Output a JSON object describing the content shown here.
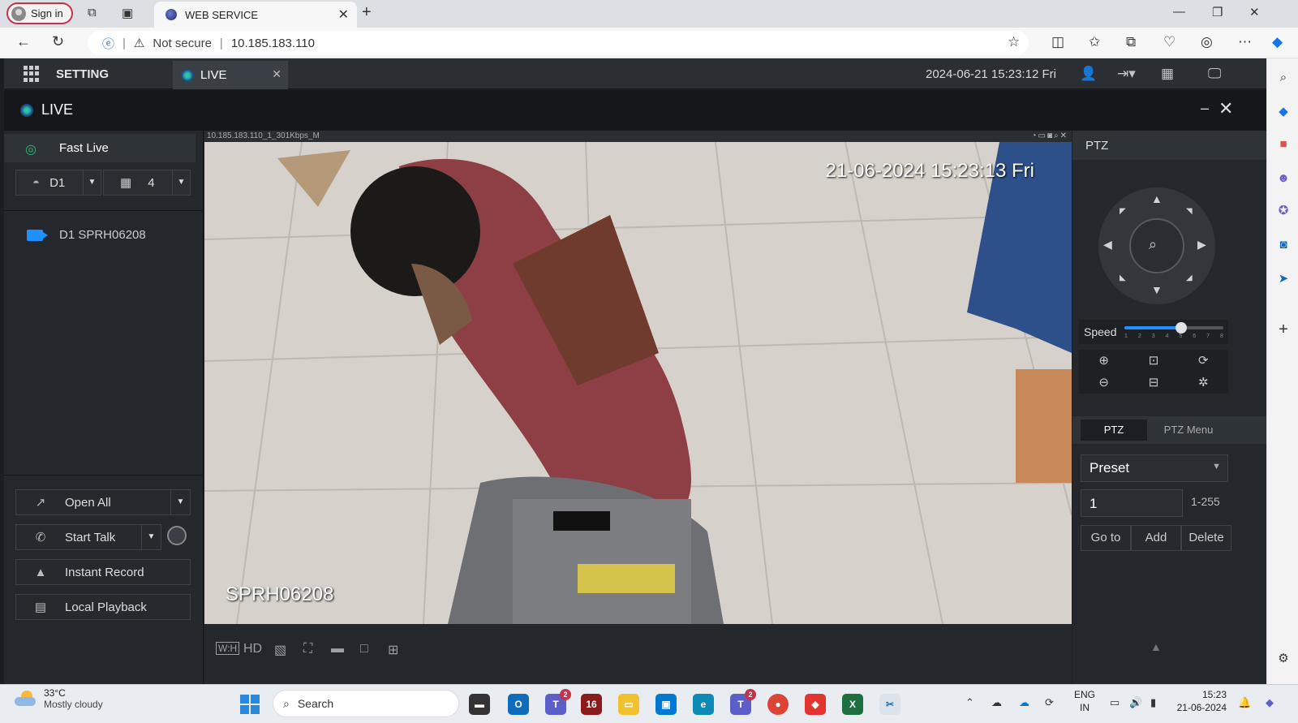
{
  "browser": {
    "signin_label": "Sign in",
    "tab_title": "WEB SERVICE",
    "not_secure_label": "Not secure",
    "url": "10.185.183.110"
  },
  "app": {
    "setting_label": "SETTING",
    "live_tab_label": "LIVE",
    "datetime": "2024-06-21 15:23:12 Fri",
    "live_panel_title": "LIVE"
  },
  "left_panel": {
    "fast_live_label": "Fast Live",
    "device_select": "D1",
    "split_select": "4",
    "device_item": "D1 SPRH06208",
    "buttons": {
      "open_all": "Open All",
      "start_talk": "Start Talk",
      "instant_record": "Instant Record",
      "local_playback": "Local Playback"
    }
  },
  "video": {
    "stream_label": "10.185.183.110_1_301Kbps_M",
    "timestamp_overlay": "21-06-2024 15:23:13 Fri",
    "channel_name_overlay": "SPRH06208",
    "toolbar": {
      "hd_label": "HD"
    }
  },
  "ptz": {
    "header": "PTZ",
    "speed_label": "Speed",
    "speed_ticks": [
      "1",
      "2",
      "3",
      "4",
      "5",
      "6",
      "7",
      "8"
    ],
    "speed_value": 5,
    "tabs": [
      "PTZ",
      "PTZ Menu"
    ],
    "preset_select": "Preset",
    "preset_number": "1",
    "preset_range": "1-255",
    "buttons": [
      "Go to",
      "Add",
      "Delete"
    ]
  },
  "taskbar": {
    "weather_temp": "33°C",
    "weather_desc": "Mostly cloudy",
    "search_placeholder": "Search",
    "teams_badge": "2",
    "teams2_badge": "2",
    "lang_top": "ENG",
    "lang_bottom": "IN",
    "time": "15:23",
    "date": "21-06-2024"
  },
  "colors": {
    "accent_blue": "#1e90ff",
    "live_green": "#2bb673",
    "app_bg": "#1e2124"
  }
}
